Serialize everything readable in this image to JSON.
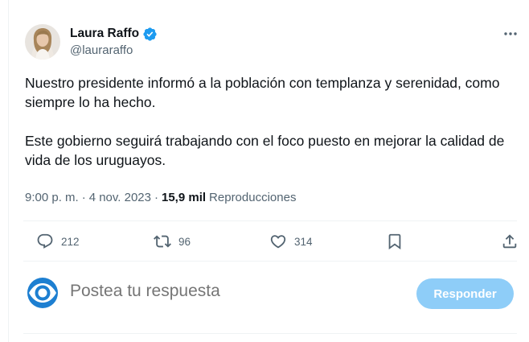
{
  "author": {
    "name": "Laura Raffo",
    "handle": "@lauraraffo",
    "verified": true
  },
  "more_icon": "more-horizontal-icon",
  "tweet": {
    "paragraphs": [
      "Nuestro presidente informó a la población con templanza y serenidad, como siempre lo ha hecho.",
      "Este gobierno seguirá trabajando con el foco puesto en mejorar la calidad de vida de los uruguayos."
    ],
    "time": "9:00 p. m.",
    "separator": "·",
    "date": "4 nov. 2023",
    "views": "15,9 mil",
    "views_label": "Reproducciones"
  },
  "actions": {
    "replies": "212",
    "retweets": "96",
    "likes": "314"
  },
  "reply": {
    "placeholder": "Postea tu respuesta",
    "button_label": "Responder"
  },
  "colors": {
    "accent": "#1d9bf0",
    "button_disabled": "#8ecdf8",
    "muted_text": "#536471",
    "main_text": "#0f1419",
    "border": "#eff3f4",
    "verified_badge": "#1d9bf0"
  }
}
